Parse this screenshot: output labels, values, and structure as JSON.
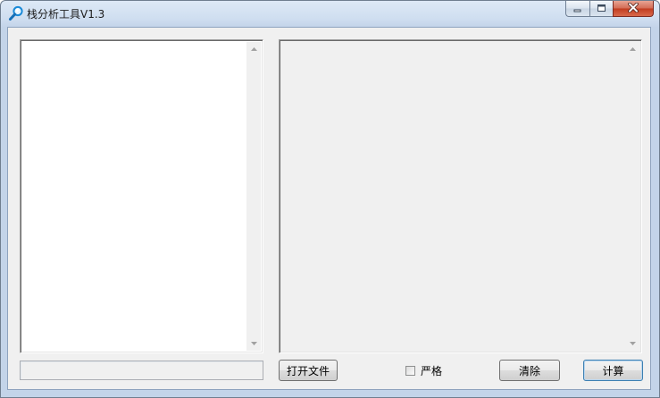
{
  "window": {
    "title": "栈分析工具V1.3"
  },
  "left_panel": {
    "list_items": [],
    "status_value": ""
  },
  "right_panel": {
    "output_text": ""
  },
  "controls": {
    "open_file_label": "打开文件",
    "strict_label": "严格",
    "strict_checked": false,
    "clear_label": "清除",
    "compute_label": "计算"
  },
  "icons": {
    "app": "magnifier-icon",
    "minimize": "minimize-icon",
    "maximize": "maximize-icon",
    "close": "close-icon",
    "scroll_up": "scroll-up-arrow-icon",
    "scroll_down": "scroll-down-arrow-icon"
  },
  "colors": {
    "titlebar": "#cfdef0",
    "client_bg": "#f0f0f0",
    "close_button": "#c13b1f"
  }
}
